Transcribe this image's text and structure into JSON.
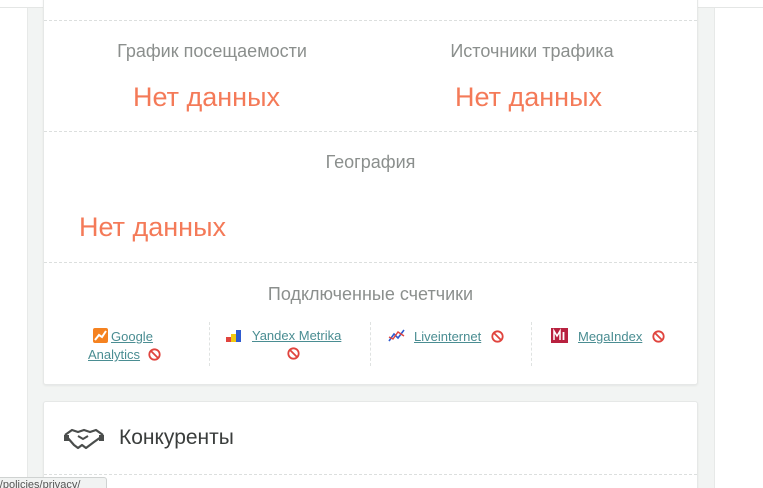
{
  "sections": {
    "visits_chart": {
      "title": "График посещаемости",
      "no_data": "Нет данных"
    },
    "traffic_sources": {
      "title": "Источники трафика",
      "no_data": "Нет данных"
    },
    "geography": {
      "title": "География",
      "no_data": "Нет данных"
    },
    "counters": {
      "title": "Подключенные счетчики",
      "items": [
        {
          "label_line1": "Google",
          "label_line2": "Analytics",
          "icon": "google-analytics-icon",
          "status": "not-connected"
        },
        {
          "label": "Yandex Metrika",
          "icon": "yandex-metrika-icon",
          "status": "not-connected"
        },
        {
          "label": "Liveinternet",
          "icon": "liveinternet-icon",
          "status": "not-connected"
        },
        {
          "label": "MegaIndex",
          "icon": "megaindex-icon",
          "status": "not-connected"
        }
      ]
    }
  },
  "competitors": {
    "title": "Конкуренты",
    "icon": "handshake-icon"
  },
  "status_bar": {
    "url_text": "ru/policies/privacy/"
  },
  "colors": {
    "no_data": "#f47a58",
    "link": "#4a8d92",
    "section_title": "#8b8f8d",
    "disabled_icon": "#e0443e"
  }
}
